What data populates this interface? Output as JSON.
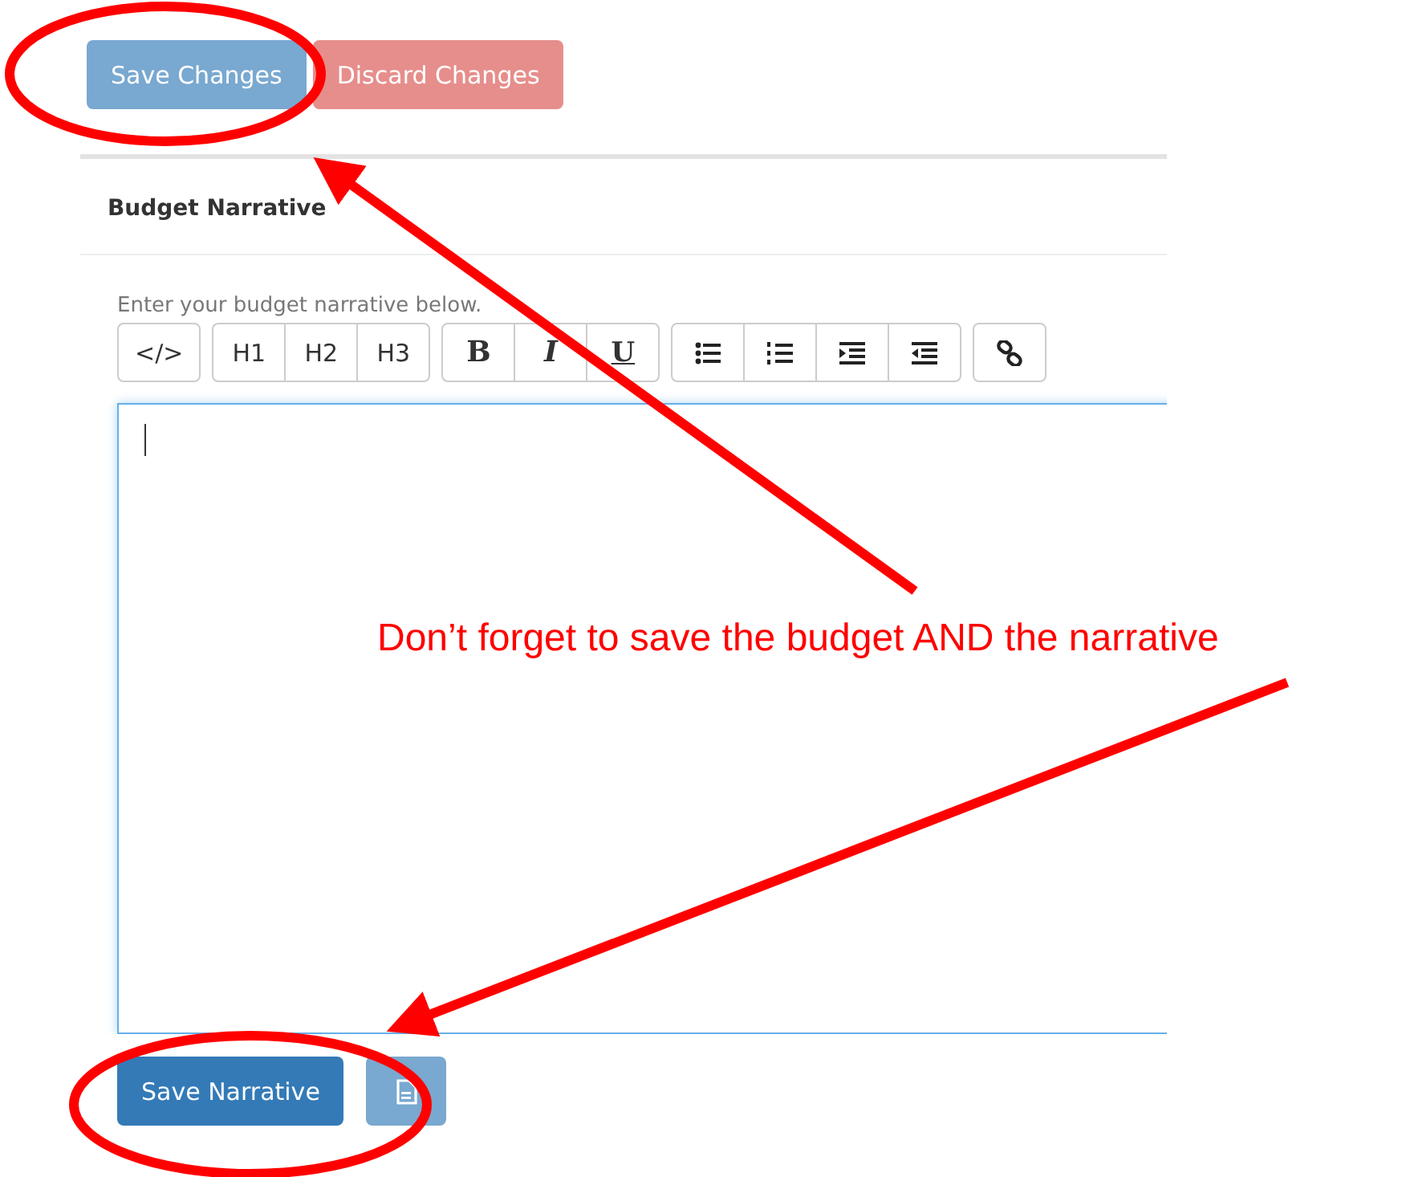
{
  "actions": [
    {
      "label": "Save Changes",
      "kind": "primary",
      "disabled": true
    },
    {
      "label": "Discard Changes",
      "kind": "danger",
      "disabled": true
    }
  ],
  "panel": {
    "title": "Budget Narrative",
    "help": "Enter your budget narrative below.",
    "toolbar": [
      [
        {
          "kind": "text",
          "label": "</>"
        }
      ],
      [
        {
          "kind": "text",
          "label": "H1"
        },
        {
          "kind": "text",
          "label": "H2"
        },
        {
          "kind": "text",
          "label": "H3"
        }
      ],
      [
        {
          "kind": "bold",
          "label": "B"
        },
        {
          "kind": "italic",
          "label": "I"
        },
        {
          "kind": "underline",
          "label": "U"
        }
      ],
      [
        {
          "kind": "bullet-list"
        },
        {
          "kind": "numbered-list"
        },
        {
          "kind": "indent"
        },
        {
          "kind": "outdent"
        }
      ],
      [
        {
          "kind": "link"
        }
      ]
    ],
    "editor": {
      "focused": true
    },
    "buttons": [
      {
        "label": "Save Narrative",
        "kind": "primary",
        "disabled": false
      },
      {
        "kind": "document",
        "disabled": true
      }
    ]
  },
  "annotation": {
    "note": "Don’t forget to save the budget AND the narrative"
  }
}
